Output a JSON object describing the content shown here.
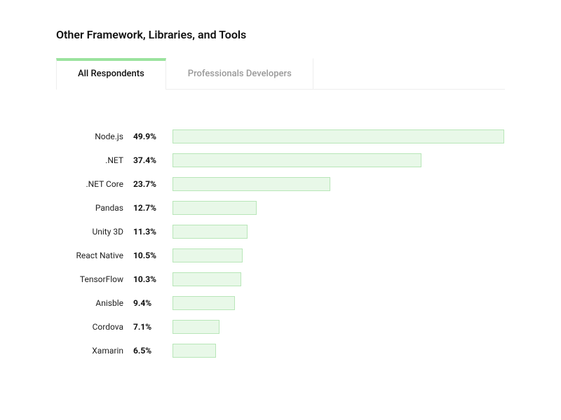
{
  "title": "Other Framework, Libraries, and Tools",
  "tabs": [
    {
      "label": "All Respondents",
      "active": true
    },
    {
      "label": "Professionals Developers",
      "active": false
    }
  ],
  "chart_data": {
    "type": "bar",
    "title": "Other Framework, Libraries, and Tools",
    "xlabel": "",
    "ylabel": "",
    "ylim": [
      0,
      50
    ],
    "categories": [
      "Node.js",
      ".NET",
      ".NET Core",
      "Pandas",
      "Unity 3D",
      "React Native",
      "TensorFlow",
      "Anisble",
      "Cordova",
      "Xamarin"
    ],
    "values": [
      49.9,
      37.4,
      23.7,
      12.7,
      11.3,
      10.5,
      10.3,
      9.4,
      7.1,
      6.5
    ],
    "value_labels": [
      "49.9%",
      "37.4%",
      "23.7%",
      "12.7%",
      "11.3%",
      "10.5%",
      "10.3%",
      "9.4%",
      "7.1%",
      "6.5%"
    ]
  }
}
